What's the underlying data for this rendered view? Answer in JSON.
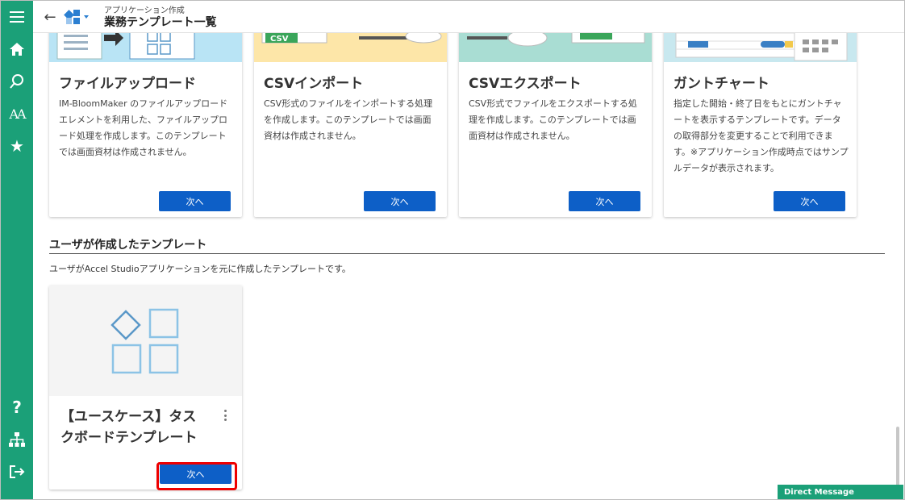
{
  "header": {
    "sub_title": "アプリケーション作成",
    "title": "業務テンプレート一覧"
  },
  "sidebar": {
    "icons": [
      "menu-icon",
      "home-icon",
      "search-icon",
      "font-icon",
      "star-icon",
      "help-icon",
      "sitemap-icon",
      "logout-icon"
    ]
  },
  "cards": [
    {
      "title": "ファイルアップロード",
      "desc": "IM-BloomMaker のファイルアップロードエレメントを利用した、ファイルアップロード処理を作成します。このテンプレートでは画面資材は作成されません。",
      "button": "次へ",
      "color": "#b9e4f5"
    },
    {
      "title": "CSVインポート",
      "desc": "CSV形式のファイルをインポートする処理を作成します。このテンプレートでは画面資材は作成されません。",
      "button": "次へ",
      "color": "#fde6a8"
    },
    {
      "title": "CSVエクスポート",
      "desc": "CSV形式でファイルをエクスポートする処理を作成します。このテンプレートでは画面資材は作成されません。",
      "button": "次へ",
      "color": "#a9ddd3"
    },
    {
      "title": "ガントチャート",
      "desc": "指定した開始・終了日をもとにガントチャートを表示するテンプレートです。データの取得部分を変更することで利用できます。※アプリケーション作成時点ではサンプルデータが表示されます。",
      "button": "次へ",
      "color": "#c8e8ef"
    }
  ],
  "user_section": {
    "title": "ユーザが作成したテンプレート",
    "desc": "ユーザがAccel Studioアプリケーションを元に作成したテンプレートです。"
  },
  "user_card": {
    "title_line1": "【ユースケース】タス",
    "title_line2": "クボードテンプレート",
    "button": "次へ"
  },
  "csv_tag": "CSV",
  "direct_message": "Direct Message"
}
